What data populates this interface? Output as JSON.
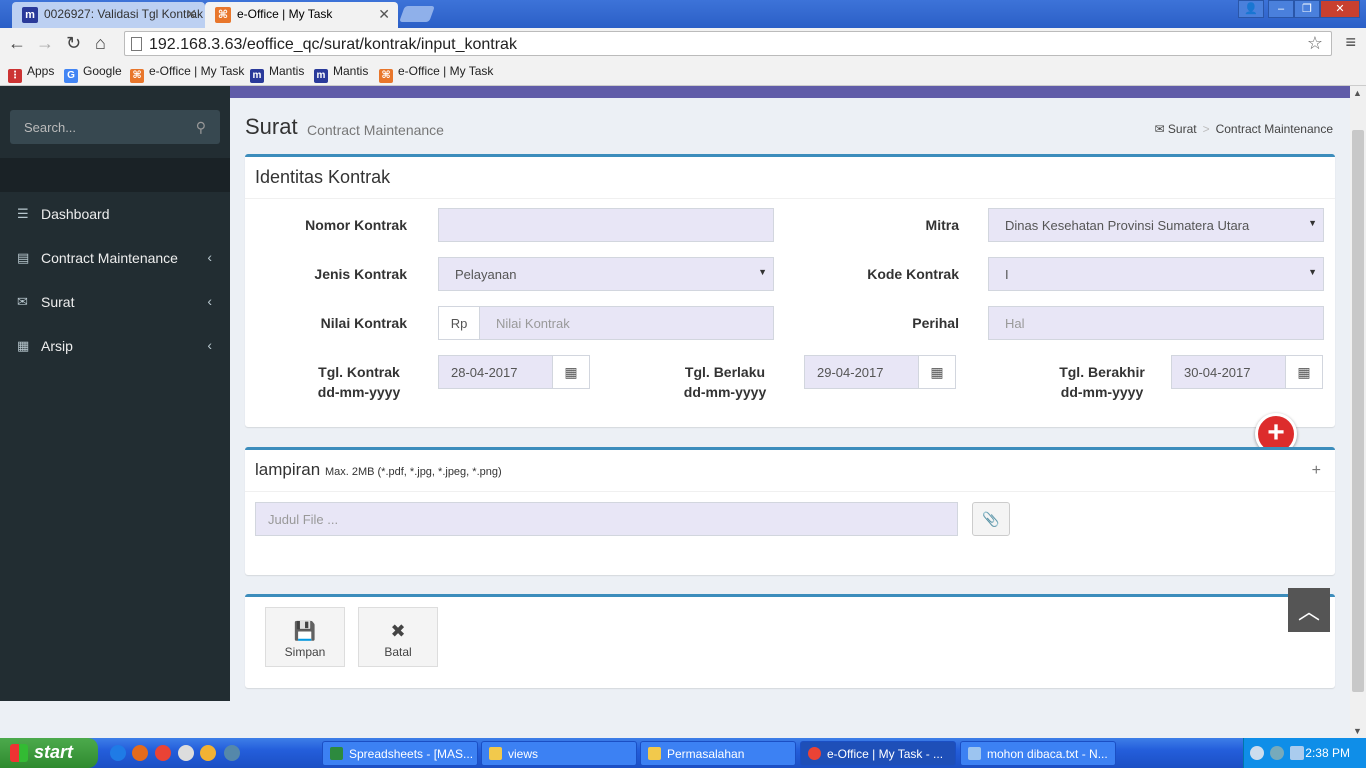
{
  "browser": {
    "tabs": [
      {
        "title": "0026927: Validasi Tgl Kontrak",
        "favicon": "mantis-icon"
      },
      {
        "title": "e-Office | My Task",
        "favicon": "eoffice-icon",
        "active": true
      }
    ],
    "url": "192.168.3.63/eoffice_qc/surat/kontrak/input_kontrak",
    "bookmarks": [
      "Apps",
      "Google",
      "e-Office | My Task",
      "Mantis",
      "Mantis",
      "e-Office | My Task"
    ]
  },
  "sidebar": {
    "search_placeholder": "Search...",
    "items": [
      {
        "label": "Dashboard",
        "icon": "dashboard-icon"
      },
      {
        "label": "Contract Maintenance",
        "icon": "document-icon"
      },
      {
        "label": "Surat",
        "icon": "envelope-icon"
      },
      {
        "label": "Arsip",
        "icon": "archive-icon"
      }
    ]
  },
  "header": {
    "title": "Surat",
    "subtitle": "Contract Maintenance",
    "breadcrumb": [
      "Surat",
      "Contract Maintenance"
    ]
  },
  "identitas": {
    "title": "Identitas Kontrak",
    "nomor_label": "Nomor Kontrak",
    "nomor_value": "",
    "mitra_label": "Mitra",
    "mitra_value": "Dinas Kesehatan Provinsi Sumatera Utara",
    "jenis_label": "Jenis Kontrak",
    "jenis_value": "Pelayanan",
    "kode_label": "Kode Kontrak",
    "kode_value": "I",
    "nilai_label": "Nilai Kontrak",
    "nilai_prefix": "Rp",
    "nilai_placeholder": "Nilai Kontrak",
    "perihal_label": "Perihal",
    "perihal_placeholder": "Hal",
    "tgl_kontrak_label": "Tgl. Kontrak",
    "tgl_kontrak_value": "28-04-2017",
    "tgl_berlaku_label": "Tgl. Berlaku",
    "tgl_berlaku_value": "29-04-2017",
    "tgl_berakhir_label": "Tgl. Berakhir",
    "tgl_berakhir_value": "30-04-2017",
    "date_format": "dd-mm-yyyy"
  },
  "lampiran": {
    "title": "lampiran",
    "note": "Max. 2MB (*.pdf, *.jpg, *.jpeg, *.png)",
    "judul_placeholder": "Judul File ..."
  },
  "actions": {
    "simpan": "Simpan",
    "batal": "Batal"
  },
  "taskbar": {
    "start": "start",
    "windows": [
      "Spreadsheets - [MAS...",
      "views",
      "Permasalahan",
      "e-Office | My Task - ...",
      "mohon dibaca.txt - N..."
    ],
    "clock": "2:38 PM"
  },
  "colors": {
    "sidebar": "#222d32",
    "accent": "#3c8dbc",
    "topbar": "#605ca8",
    "input": "#e8e6f6",
    "add_button": "#dd2c2c"
  }
}
